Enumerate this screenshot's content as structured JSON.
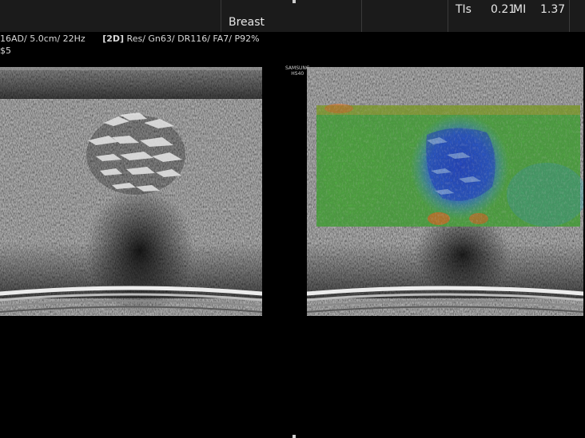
{
  "header": {
    "exam_label": "Breast",
    "tis_label": "TIs",
    "tis_value": "0.21",
    "mi_label": "MI",
    "mi_value": "1.37"
  },
  "parameters": {
    "probe_line": "16AD∕ 5.0cm∕ 22Hz",
    "mode_label": "[2D]",
    "settings_line": "Res∕ Gn63∕ DR116∕ FA7∕ P92%",
    "second_line": "$5"
  },
  "right_image": {
    "watermark_line1": "SAMSUNG",
    "watermark_line2": "HS40"
  },
  "colors": {
    "elasto_soft": "#4caf50",
    "elasto_hard": "#2a4fd0",
    "elasto_stiff_edge": "#e07a30"
  }
}
